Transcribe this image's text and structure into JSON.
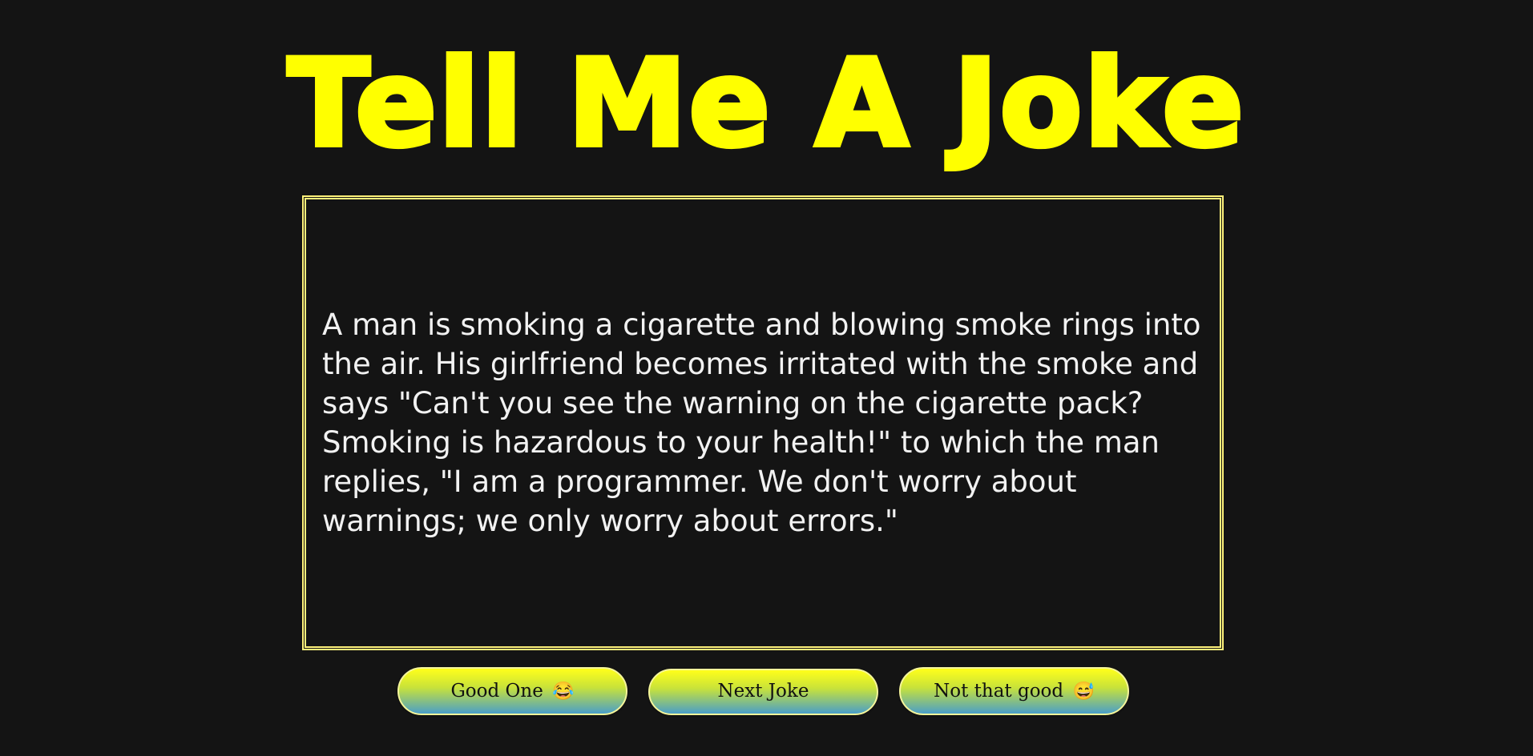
{
  "header": {
    "title": "Tell Me A Joke"
  },
  "joke": {
    "text": "A man is smoking a cigarette and blowing smoke rings into the air. His girlfriend becomes irritated with the smoke and says \"Can't you see the warning on the cigarette pack? Smoking is hazardous to your health!\" to which the man replies, \"I am a programmer. We don't worry about warnings; we only worry about errors.\""
  },
  "buttons": {
    "good_label": "Good One",
    "good_emoji": "😂",
    "next_label": "Next Joke",
    "bad_label": "Not that good",
    "bad_emoji": "😅"
  },
  "colors": {
    "background": "#141414",
    "title": "#ffff00",
    "border": "#fff27a",
    "text": "#f2f2f2"
  }
}
